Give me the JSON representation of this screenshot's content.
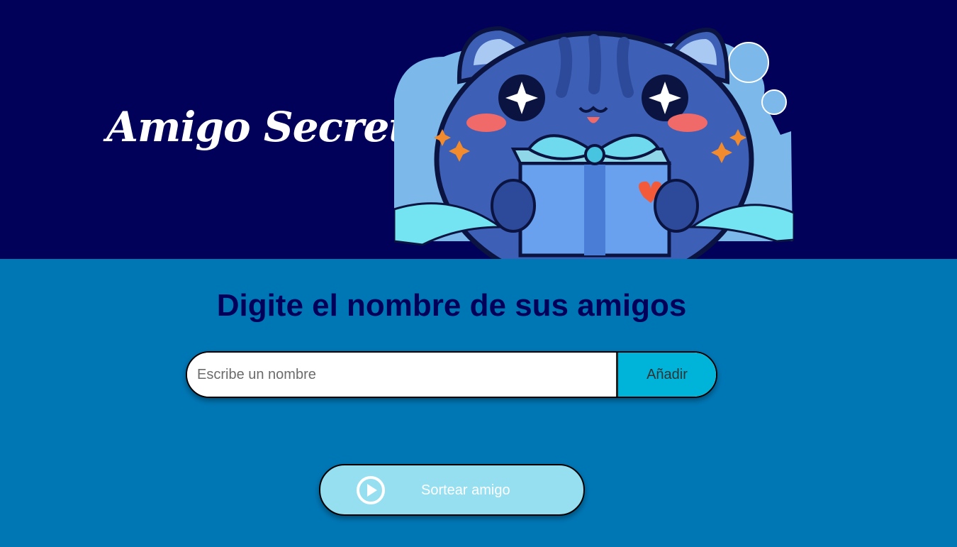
{
  "header": {
    "title": "Amigo Secreto",
    "illustration_icon": "cat-with-gift-illustration"
  },
  "main": {
    "subtitle": "Digite el nombre de sus amigos",
    "input": {
      "placeholder": "Escribe un nombre",
      "value": ""
    },
    "add_button_label": "Añadir",
    "draw_button_label": "Sortear amigo",
    "draw_button_icon": "play-circle-icon"
  },
  "colors": {
    "header_bg": "#020159",
    "main_bg": "#0077b5",
    "subtitle": "#020159",
    "add_button_bg": "#00b3d9",
    "draw_button_bg": "#95dff0"
  }
}
